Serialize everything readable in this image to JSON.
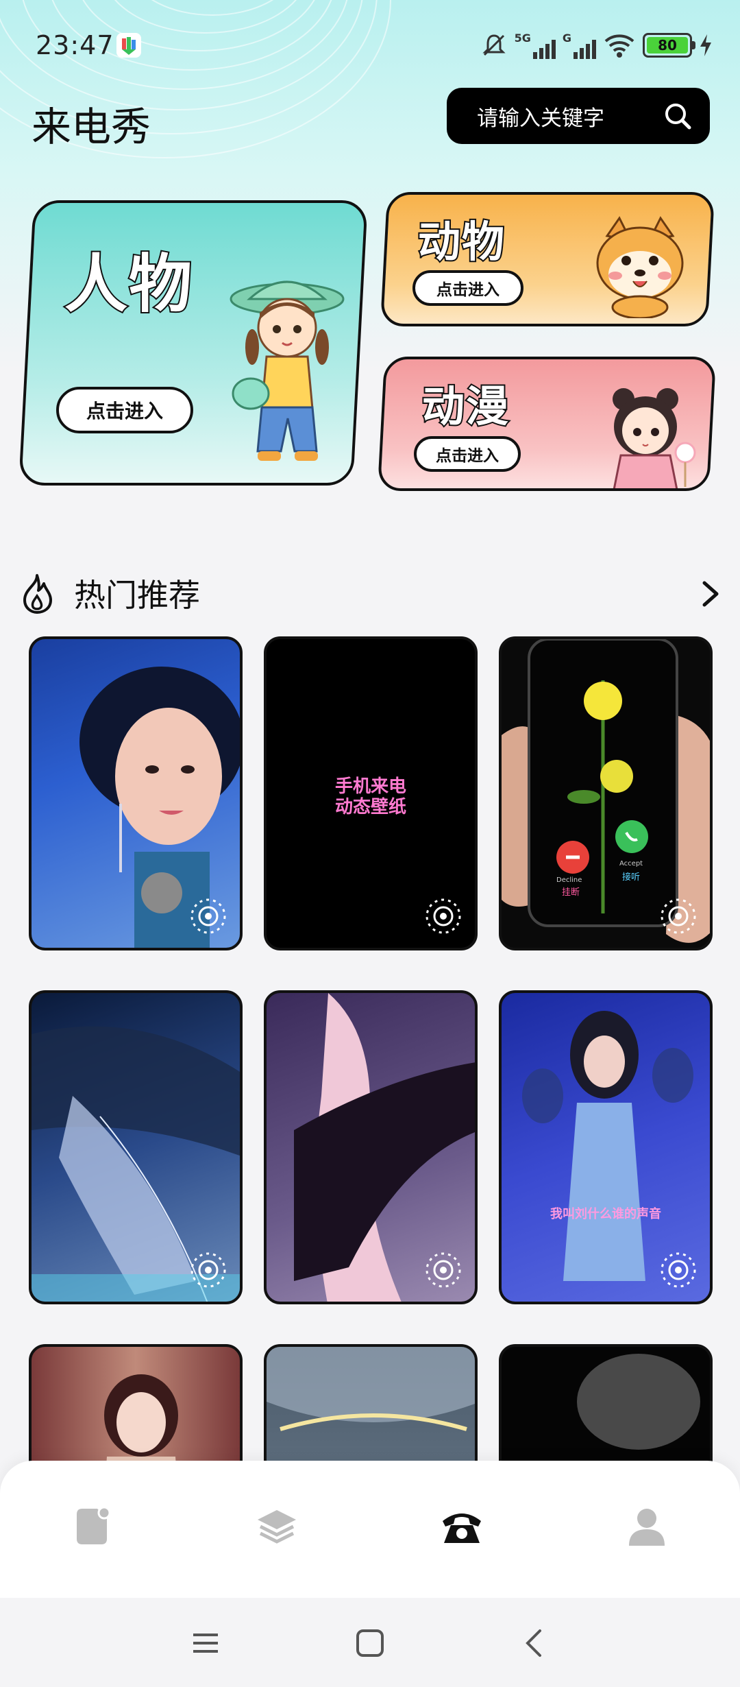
{
  "status_bar": {
    "time": "23:47",
    "battery": "80",
    "signal_1": "5G",
    "signal_2": "G"
  },
  "header": {
    "title": "来电秀",
    "search_placeholder": "请输入关键字"
  },
  "categories": [
    {
      "title": "人物",
      "button": "点击进入"
    },
    {
      "title": "动物",
      "button": "点击进入"
    },
    {
      "title": "动漫",
      "button": "点击进入"
    }
  ],
  "section": {
    "title": "热门推荐"
  },
  "thumbnails": [
    {
      "overlay_text": ""
    },
    {
      "overlay_text": "手机来电\n动态壁纸"
    },
    {
      "overlay_text": "",
      "decline_label": "Decline",
      "decline_cn": "挂断",
      "accept_label": "Accept",
      "accept_cn": "接听"
    },
    {
      "overlay_text": ""
    },
    {
      "overlay_text": ""
    },
    {
      "overlay_text": "我叫刘什么谁的声音"
    },
    {
      "overlay_text": ""
    },
    {
      "overlay_text": ""
    },
    {
      "overlay_text": ""
    }
  ],
  "bottom_nav": {
    "items": [
      "wallpaper-icon",
      "layers-icon",
      "phone-icon",
      "profile-icon"
    ],
    "active": "phone-icon"
  },
  "colors": {
    "accent": "#111111",
    "people_card": "#6fdbd2",
    "animal_card": "#f8b24b",
    "anime_card": "#f39a9d"
  }
}
